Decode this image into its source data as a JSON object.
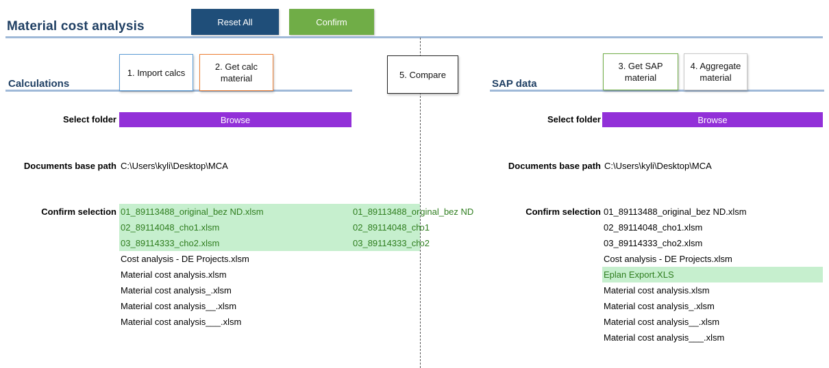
{
  "header": {
    "title": "Material cost analysis",
    "reset_label": "Reset All",
    "confirm_label": "Confirm"
  },
  "colors": {
    "title": "#1f3f63",
    "reset_bg": "#1f4e79",
    "confirm_bg": "#70ad47",
    "browse_bg": "#9230d8",
    "selected_bg": "#c6efce",
    "selected_text": "#2e7d1e",
    "divider": "#9fb9d8"
  },
  "calculations": {
    "section_title": "Calculations",
    "steps": [
      {
        "label": "1. Import calcs"
      },
      {
        "label": "2. Get calc material"
      }
    ],
    "select_folder_label": "Select folder",
    "browse_label": "Browse",
    "base_path_label": "Documents base path",
    "base_path": "C:\\Users\\kyli\\Desktop\\MCA",
    "confirm_selection_label": "Confirm selection",
    "files": [
      {
        "name": "01_89113488_original_bez ND.xlsm",
        "selected": true
      },
      {
        "name": "02_89114048_cho1.xlsm",
        "selected": true
      },
      {
        "name": "03_89114333_cho2.xlsm",
        "selected": true
      },
      {
        "name": "Cost analysis - DE Projects.xlsm",
        "selected": false
      },
      {
        "name": "Material cost analysis.xlsm",
        "selected": false
      },
      {
        "name": "Material cost analysis_.xlsm",
        "selected": false
      },
      {
        "name": "Material cost analysis__.xlsm",
        "selected": false
      },
      {
        "name": "Material cost analysis___.xlsm",
        "selected": false
      }
    ],
    "confirmed": [
      "01_89113488_original_bez ND",
      "02_89114048_cho1",
      "03_89114333_cho2"
    ]
  },
  "compare": {
    "label": "5. Compare"
  },
  "sap": {
    "section_title": "SAP data",
    "steps": [
      {
        "label": "3. Get SAP material"
      },
      {
        "label": "4. Aggregate material"
      }
    ],
    "select_folder_label": "Select folder",
    "browse_label": "Browse",
    "base_path_label": "Documents base path",
    "base_path": "C:\\Users\\kyli\\Desktop\\MCA",
    "confirm_selection_label": "Confirm selection",
    "files": [
      {
        "name": "01_89113488_original_bez ND.xlsm",
        "selected": false
      },
      {
        "name": "02_89114048_cho1.xlsm",
        "selected": false
      },
      {
        "name": "03_89114333_cho2.xlsm",
        "selected": false
      },
      {
        "name": "Cost analysis - DE Projects.xlsm",
        "selected": false
      },
      {
        "name": "Eplan Export.XLS",
        "selected": true
      },
      {
        "name": "Material cost analysis.xlsm",
        "selected": false
      },
      {
        "name": "Material cost analysis_.xlsm",
        "selected": false
      },
      {
        "name": "Material cost analysis__.xlsm",
        "selected": false
      },
      {
        "name": "Material cost analysis___.xlsm",
        "selected": false
      }
    ]
  }
}
